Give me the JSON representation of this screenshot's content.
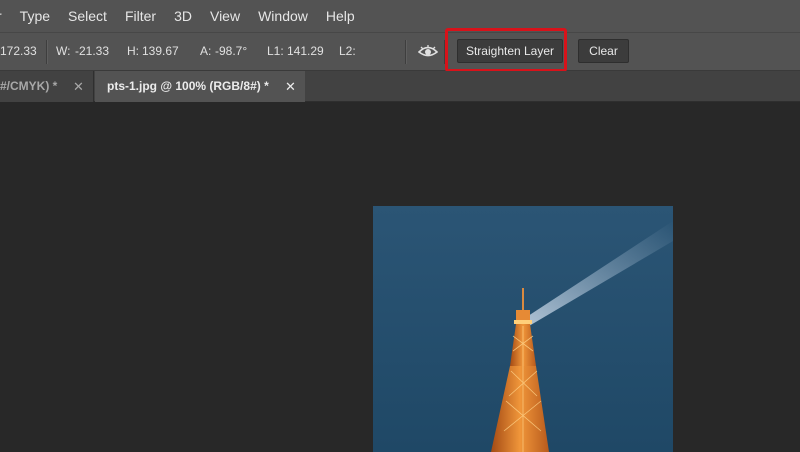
{
  "menu": {
    "items": [
      "Type",
      "Select",
      "Filter",
      "3D",
      "View",
      "Window",
      "Help"
    ]
  },
  "options": {
    "x_value": "172.33",
    "w_label": "W:",
    "w_value": "-21.33",
    "h_label": "H:",
    "h_value": "139.67",
    "a_label": "A:",
    "a_value": "-98.7°",
    "l1_label": "L1:",
    "l1_value": "141.29",
    "l2_label": "L2:",
    "eye_icon": "use-measurement-scale-icon",
    "straighten_label": "Straighten Layer",
    "clear_label": "Clear"
  },
  "tabs": {
    "inactive_label": "#/CMYK) *",
    "active_label": "pts-1.jpg @ 100% (RGB/8#) *",
    "close_glyph": "✕"
  },
  "colors": {
    "highlight": "#d8121a",
    "sky": "#2a5577",
    "tower": "#e07a28"
  }
}
